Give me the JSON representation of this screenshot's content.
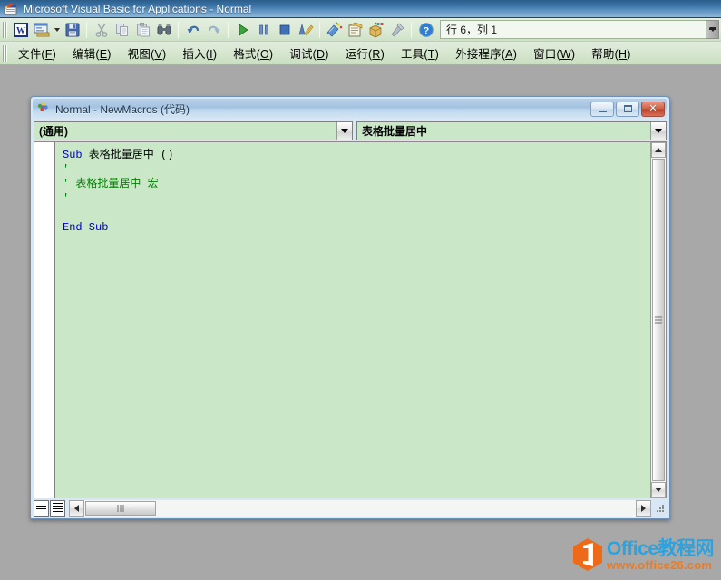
{
  "app": {
    "title": "Microsoft Visual Basic for Applications - Normal",
    "icon": "vba-app-icon"
  },
  "toolbar": {
    "buttons": [
      {
        "name": "view-word-button",
        "icon": "word-document-icon",
        "tooltip": "View Microsoft Word"
      },
      {
        "name": "insert-userform-button",
        "icon": "userform-icon",
        "tooltip": "Insert UserForm"
      },
      {
        "name": "insert-dropdown-button",
        "icon": "chevron-down-icon",
        "tooltip": "Insert"
      },
      {
        "name": "save-button",
        "icon": "floppy-disk-icon",
        "tooltip": "Save Normal"
      },
      {
        "name": "cut-button",
        "icon": "scissors-icon",
        "tooltip": "Cut"
      },
      {
        "name": "copy-button",
        "icon": "copy-icon",
        "tooltip": "Copy"
      },
      {
        "name": "paste-button",
        "icon": "clipboard-paste-icon",
        "tooltip": "Paste"
      },
      {
        "name": "find-button",
        "icon": "binoculars-icon",
        "tooltip": "Find"
      },
      {
        "name": "undo-button",
        "icon": "undo-arrow-icon",
        "tooltip": "Undo"
      },
      {
        "name": "redo-button",
        "icon": "redo-arrow-icon",
        "tooltip": "Redo"
      },
      {
        "name": "run-button",
        "icon": "play-triangle-icon",
        "tooltip": "Run Sub/UserForm"
      },
      {
        "name": "break-button",
        "icon": "pause-icon",
        "tooltip": "Break"
      },
      {
        "name": "reset-button",
        "icon": "stop-square-icon",
        "tooltip": "Reset"
      },
      {
        "name": "design-mode-button",
        "icon": "ruler-pencil-icon",
        "tooltip": "Design Mode"
      },
      {
        "name": "project-explorer-button",
        "icon": "project-explorer-icon",
        "tooltip": "Project Explorer"
      },
      {
        "name": "properties-window-button",
        "icon": "properties-icon",
        "tooltip": "Properties Window"
      },
      {
        "name": "object-browser-button",
        "icon": "object-browser-icon",
        "tooltip": "Object Browser"
      },
      {
        "name": "toolbox-button",
        "icon": "toolbox-icon",
        "tooltip": "Toolbox"
      },
      {
        "name": "help-button",
        "icon": "help-question-icon",
        "tooltip": "Help"
      }
    ],
    "status_text": "行 6，列 1",
    "overflow_label": "toolbar-options"
  },
  "menubar": {
    "items": [
      {
        "name": "menu-file",
        "pre": "文件(",
        "key": "F",
        "post": ")"
      },
      {
        "name": "menu-edit",
        "pre": "编辑(",
        "key": "E",
        "post": ")"
      },
      {
        "name": "menu-view",
        "pre": "视图(",
        "key": "V",
        "post": ")"
      },
      {
        "name": "menu-insert",
        "pre": "插入(",
        "key": "I",
        "post": ")"
      },
      {
        "name": "menu-format",
        "pre": "格式(",
        "key": "O",
        "post": ")"
      },
      {
        "name": "menu-debug",
        "pre": "调试(",
        "key": "D",
        "post": ")"
      },
      {
        "name": "menu-run",
        "pre": "运行(",
        "key": "R",
        "post": ")"
      },
      {
        "name": "menu-tools",
        "pre": "工具(",
        "key": "T",
        "post": ")"
      },
      {
        "name": "menu-addins",
        "pre": "外接程序(",
        "key": "A",
        "post": ")"
      },
      {
        "name": "menu-window",
        "pre": "窗口(",
        "key": "W",
        "post": ")"
      },
      {
        "name": "menu-help",
        "pre": "帮助(",
        "key": "H",
        "post": ")"
      }
    ]
  },
  "code_window": {
    "title": "Normal - NewMacros (代码)",
    "icon": "vba-module-icon",
    "controls": {
      "minimize": "minimize-button",
      "maximize": "maximize-button",
      "close": "close-button"
    },
    "object_combo": {
      "value": "(通用)",
      "name": "object-dropdown"
    },
    "procedure_combo": {
      "value": "表格批量居中",
      "name": "procedure-dropdown"
    },
    "code_lines": [
      {
        "segments": [
          {
            "text": "Sub",
            "style": "kw"
          },
          {
            "text": " 表格批量居中 ()",
            "style": "idt"
          }
        ]
      },
      {
        "segments": [
          {
            "text": "'",
            "style": "cmt"
          }
        ]
      },
      {
        "segments": [
          {
            "text": "' 表格批量居中 宏",
            "style": "cmt"
          }
        ]
      },
      {
        "segments": [
          {
            "text": "'",
            "style": "cmt"
          }
        ]
      },
      {
        "segments": [
          {
            "text": "",
            "style": "idt"
          }
        ]
      },
      {
        "segments": [
          {
            "text": "End Sub",
            "style": "kw"
          }
        ]
      }
    ],
    "view_buttons": [
      {
        "name": "procedure-view-button",
        "icon": "procedure-view-icon"
      },
      {
        "name": "full-module-view-button",
        "icon": "full-module-view-icon"
      }
    ],
    "scrollbars": {
      "vertical": {
        "name": "code-vertical-scrollbar",
        "up": "scroll-up-arrow-icon",
        "down": "scroll-down-arrow-icon"
      },
      "horizontal": {
        "name": "code-horizontal-scrollbar",
        "left": "scroll-left-arrow-icon",
        "right": "scroll-right-arrow-icon"
      }
    }
  },
  "watermark": {
    "line1": "Office教程网",
    "line2": "www.office26.com",
    "icon": "office-hex-logo"
  },
  "colors": {
    "titlebar_blue": "#3f78ab",
    "toolbar_green": "#d8e9d2",
    "code_bg": "#cae8c8",
    "workspace_gray": "#a8a8a8",
    "keyword_blue": "#0000c0",
    "comment_green": "#008000",
    "close_red": "#cf5f45",
    "watermark_blue": "#2aa3e0",
    "watermark_orange": "#f07a1e"
  }
}
